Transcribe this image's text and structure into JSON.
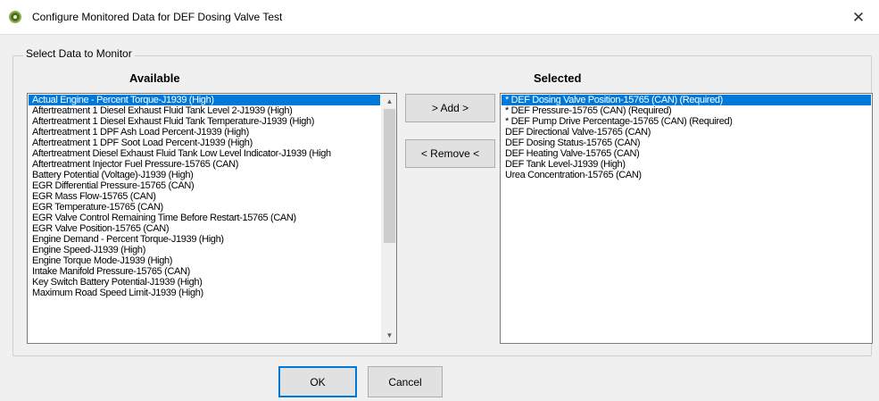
{
  "window": {
    "title": "Configure Monitored Data for DEF Dosing Valve Test",
    "close_glyph": "✕",
    "icon": "app-logo-icon"
  },
  "group": {
    "legend": "Select Data to Monitor"
  },
  "available": {
    "heading": "Available",
    "items": [
      "Actual Engine - Percent Torque-J1939 (High)",
      "Aftertreatment 1 Diesel Exhaust Fluid Tank Level 2-J1939 (High)",
      "Aftertreatment 1 Diesel Exhaust Fluid Tank Temperature-J1939 (High)",
      "Aftertreatment 1 DPF Ash Load Percent-J1939 (High)",
      "Aftertreatment 1 DPF Soot Load Percent-J1939 (High)",
      "Aftertreatment Diesel Exhaust Fluid Tank Low Level Indicator-J1939 (High",
      "Aftertreatment Injector Fuel Pressure-15765 (CAN)",
      "Battery Potential (Voltage)-J1939 (High)",
      "EGR Differential Pressure-15765 (CAN)",
      "EGR Mass Flow-15765 (CAN)",
      "EGR Temperature-15765 (CAN)",
      "EGR Valve Control Remaining Time Before Restart-15765 (CAN)",
      "EGR Valve Position-15765 (CAN)",
      "Engine Demand - Percent Torque-J1939 (High)",
      "Engine Speed-J1939 (High)",
      "Engine Torque Mode-J1939 (High)",
      "Intake Manifold Pressure-15765 (CAN)",
      "Key Switch Battery Potential-J1939 (High)",
      "Maximum Road Speed Limit-J1939 (High)"
    ],
    "selected_index": 0,
    "scroll_up_glyph": "▲",
    "scroll_down_glyph": "▼"
  },
  "selected": {
    "heading": "Selected",
    "items": [
      "* DEF Dosing Valve Position-15765 (CAN) (Required)",
      "* DEF Pressure-15765 (CAN) (Required)",
      "* DEF Pump Drive Percentage-15765 (CAN) (Required)",
      "DEF Directional Valve-15765 (CAN)",
      "DEF Dosing Status-15765 (CAN)",
      "DEF Heating Valve-15765 (CAN)",
      "DEF Tank Level-J1939 (High)",
      "Urea Concentration-15765 (CAN)"
    ],
    "selected_index": 0
  },
  "buttons": {
    "add": "> Add >",
    "remove": "< Remove <",
    "ok": "OK",
    "cancel": "Cancel"
  },
  "colors": {
    "selection": "#0078d7",
    "window_bg": "#f0f0f0"
  }
}
